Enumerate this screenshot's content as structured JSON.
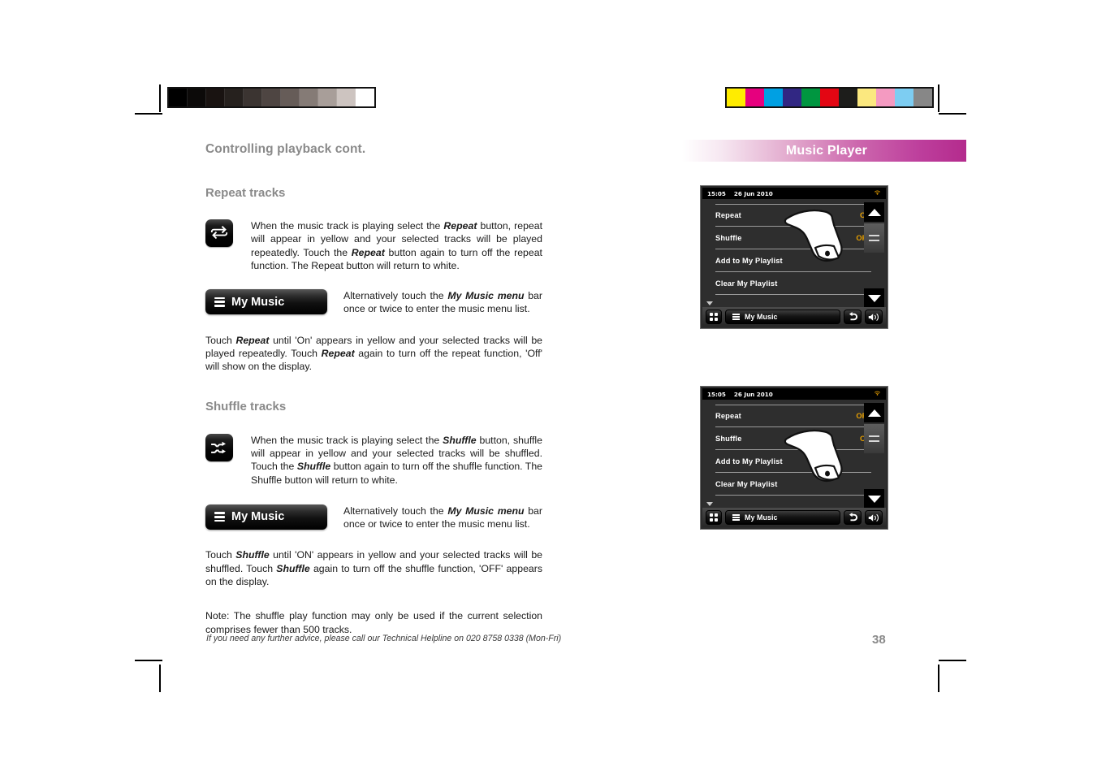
{
  "document": {
    "section_title": "Controlling playback cont.",
    "page_number": "38",
    "footer_note": "If you need any further advice, please call our Technical Helpline on 020 8758 0338 (Mon-Fri)",
    "right_header": "Music Player"
  },
  "colors": {
    "header_magenta": "#b42b8d",
    "header_light": "#ffffff",
    "heading_gray": "#8a8a8a",
    "screen_value_yellow": "#e8a000",
    "screen_bg": "#2e2e2e"
  },
  "calibration": {
    "grayscale_swatches": [
      "#000000",
      "#0c0a09",
      "#191311",
      "#26211e",
      "#3b3431",
      "#4e4542",
      "#665c58",
      "#857b76",
      "#a89e99",
      "#cdc4c0",
      "#ffffff"
    ],
    "color_swatches": [
      "#ffec00",
      "#e6007e",
      "#00a0e3",
      "#312783",
      "#009640",
      "#e30613",
      "#1d1d1b",
      "#fbe87f",
      "#f49ac1",
      "#7dcdf2",
      "#878787"
    ]
  },
  "repeat_section": {
    "heading": "Repeat tracks",
    "icon": "repeat-icon",
    "body": "When the music track is playing select the <b>Repeat</b> button, repeat will appear in yellow and your selected tracks will be played repeatedly. Touch the <b>Repeat</b> button again to turn off the repeat function. The Repeat button will return to white.",
    "button_label": "My Music",
    "alt_text": "Alternatively touch the <b>My Music menu</b> bar once or twice to enter the music menu list.",
    "footer_text": "Touch <b>Repeat</b> until 'On' appears in yellow and your selected tracks will be played repeatedly. Touch <b>Repeat</b> again to turn off the repeat function, 'Off' will show on the display."
  },
  "shuffle_section": {
    "heading": "Shuffle tracks",
    "icon": "shuffle-icon",
    "body": "When the music track is playing select the <b>Shuffle</b> button, shuffle will appear in yellow and your selected tracks will be shuffled. Touch  the <b>Shuffle</b> button again to turn off the shuffle function. The Shuffle button will return to white.",
    "button_label": "My Music",
    "alt_text": "Alternatively touch the <b>My Music menu</b> bar once or twice to enter the music menu list.",
    "footer_text": "Touch <b>Shuffle</b> until 'ON' appears in yellow and your selected tracks will be shuffled. Touch <b>Shuffle</b> again to turn off the shuffle function, 'OFF' appears on the display.",
    "note": "Note: The shuffle play function may only be used if the current selection comprises fewer than 500 tracks."
  },
  "screens": [
    {
      "id": "repeat-on-screen",
      "status": {
        "time": "15:05",
        "date": "26 Jun 2010",
        "wifi_icon": "wifi-icon"
      },
      "menu": [
        {
          "label": "Repeat",
          "value": "ON"
        },
        {
          "label": "Shuffle",
          "value": "OFF"
        },
        {
          "label": "Add to My Playlist",
          "value": ""
        },
        {
          "label": "Clear My Playlist",
          "value": ""
        }
      ],
      "toolbar": {
        "grid_icon": "grid-icon",
        "menu_label": "My Music",
        "back_icon": "back-arrow-icon",
        "volume_icon": "volume-icon"
      },
      "scroll": {
        "up": "scroll-up-icon",
        "menu": "menu-lines-icon",
        "down": "scroll-down-icon"
      },
      "hand_pointer_row": 1
    },
    {
      "id": "shuffle-on-screen",
      "status": {
        "time": "15:05",
        "date": "26 Jun 2010",
        "wifi_icon": "wifi-icon"
      },
      "menu": [
        {
          "label": "Repeat",
          "value": "OFF"
        },
        {
          "label": "Shuffle",
          "value": "ON"
        },
        {
          "label": "Add to My Playlist",
          "value": ""
        },
        {
          "label": "Clear My Playlist",
          "value": ""
        }
      ],
      "toolbar": {
        "grid_icon": "grid-icon",
        "menu_label": "My Music",
        "back_icon": "back-arrow-icon",
        "volume_icon": "volume-icon"
      },
      "scroll": {
        "up": "scroll-up-icon",
        "menu": "menu-lines-icon",
        "down": "scroll-down-icon"
      },
      "hand_pointer_row": 2
    }
  ]
}
